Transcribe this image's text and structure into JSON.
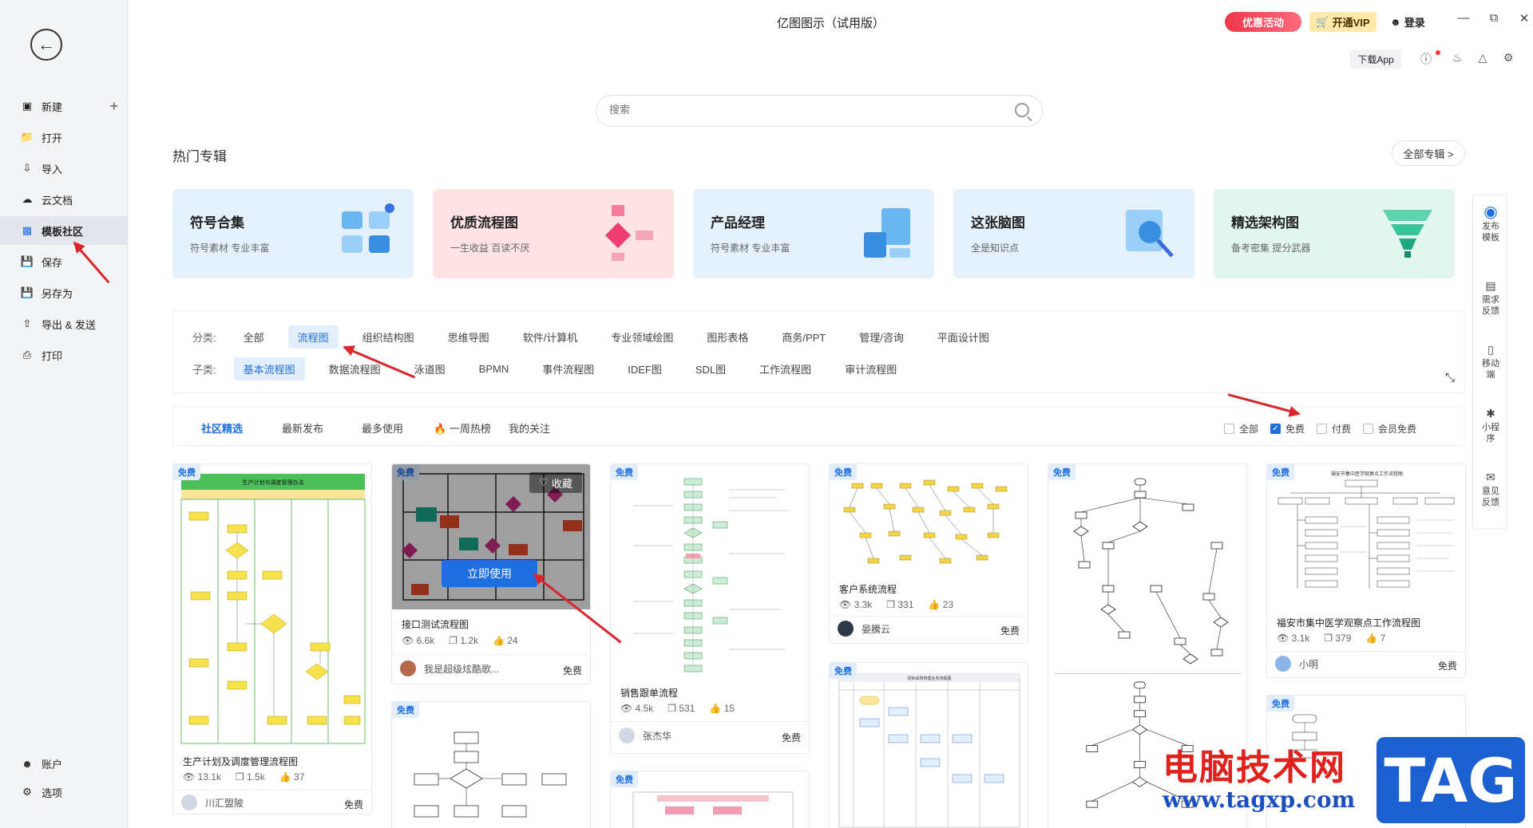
{
  "window": {
    "title": "亿图图示（试用版）"
  },
  "sidebar": {
    "items": [
      {
        "label": "新建"
      },
      {
        "label": "打开"
      },
      {
        "label": "导入"
      },
      {
        "label": "云文档"
      },
      {
        "label": "模板社区"
      },
      {
        "label": "保存"
      },
      {
        "label": "另存为"
      },
      {
        "label": "导出 & 发送"
      },
      {
        "label": "打印"
      }
    ],
    "bottom": [
      {
        "label": "账户"
      },
      {
        "label": "选项"
      }
    ]
  },
  "topbar": {
    "promo": "优惠活动",
    "vip": "开通VIP",
    "login": "登录",
    "download_app": "下载App"
  },
  "search": {
    "placeholder": "搜索"
  },
  "hot": {
    "title": "热门专辑",
    "all_button": "全部专辑 >",
    "cards": [
      {
        "title": "符号合集",
        "subtitle": "符号素材 专业丰富",
        "color": "#e4f1fb"
      },
      {
        "title": "优质流程图",
        "subtitle": "一生收益 百读不厌",
        "color": "#fde3e6"
      },
      {
        "title": "产品经理",
        "subtitle": "符号素材 专业丰富",
        "color": "#e4f1fb"
      },
      {
        "title": "这张脑图",
        "subtitle": "全是知识点",
        "color": "#e4f1fb"
      },
      {
        "title": "精选架构图",
        "subtitle": "备考密集 提分武器",
        "color": "#e2f6ef"
      }
    ]
  },
  "filter": {
    "category_label": "分类:",
    "categories": [
      "全部",
      "流程图",
      "组织结构图",
      "思维导图",
      "软件/计算机",
      "专业领域绘图",
      "图形表格",
      "商务/PPT",
      "管理/咨询",
      "平面设计图"
    ],
    "sub_label": "子类:",
    "subcategories": [
      "基本流程图",
      "数据流程图",
      "泳道图",
      "BPMN",
      "事件流程图",
      "IDEF图",
      "SDL图",
      "工作流程图",
      "审计流程图"
    ]
  },
  "tabs": [
    "社区精选",
    "最新发布",
    "最多使用",
    "一周热榜",
    "我的关注"
  ],
  "price_filter": [
    "全部",
    "免费",
    "付费",
    "会员免费"
  ],
  "cards": [
    {
      "badge": "免费",
      "thumb_title": "生产计划与调度管理办法",
      "title": "生产计划及调度管理流程图",
      "views": "13.1k",
      "copies": "1.5k",
      "likes": "37",
      "author": "川汇盟陂",
      "price": "免费"
    },
    {
      "badge": "免费",
      "title": "接口测试流程图",
      "views": "6.6k",
      "copies": "1.2k",
      "likes": "24",
      "author": "我是超级炫酷歌...",
      "price": "免费",
      "use_label": "立即使用",
      "fav_label": "收藏"
    },
    {
      "badge": "免费",
      "title": "销售跟单流程",
      "views": "4.5k",
      "copies": "531",
      "likes": "15",
      "author": "张杰华",
      "price": "免费"
    },
    {
      "badge": "免费",
      "title": "客户系统流程",
      "views": "3.3k",
      "copies": "331",
      "likes": "23",
      "author": "晏騰云",
      "price": "免费"
    },
    {
      "badge": "免费"
    },
    {
      "badge": "免费",
      "thumb_title": "福安市集中医学观察点工作流程图",
      "title": "福安市集中医学观察点工作流程图",
      "views": "3.1k",
      "copies": "379",
      "likes": "7",
      "author": "小明",
      "price": "免费"
    },
    {
      "badge": "免费"
    },
    {
      "badge": "免费"
    },
    {
      "badge": "免费",
      "thumb_title": "招标采购管理业务流程图"
    },
    {
      "badge": "免费"
    }
  ],
  "right_panel": [
    "发布\n模板",
    "需求\n反馈",
    "移动\n端",
    "小程\n序",
    "意见\n反馈"
  ],
  "watermark": {
    "site_cn": "电脑技术网",
    "url": "www.tagxp.com",
    "tag": "TAG"
  }
}
